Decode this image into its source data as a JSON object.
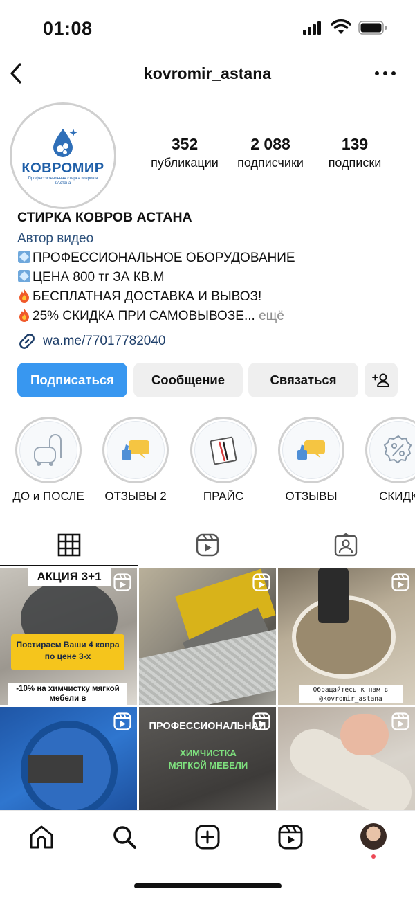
{
  "status": {
    "time": "01:08"
  },
  "header": {
    "username": "kovromir_astana"
  },
  "avatar": {
    "logo_word": "КОВРОМИР",
    "logo_sub": "Профессиональная стирка ковров в г.Астана"
  },
  "stats": [
    {
      "num": "352",
      "label": "публикации"
    },
    {
      "num": "2 088",
      "label": "подписчики"
    },
    {
      "num": "139",
      "label": "подписки"
    }
  ],
  "bio": {
    "name": "СТИРКА КОВРОВ АСТАНА",
    "category": "Автор видео",
    "line1": "ПРОФЕССИОНАЛЬНОЕ ОБОРУДОВАНИЕ",
    "line2": "ЦЕНА 800 тг ЗА КВ.М",
    "line3": "БЕСПЛАТНАЯ ДОСТАВКА И ВЫВОЗ!",
    "line4": "25% СКИДКА ПРИ САМОВЫВОЗЕ...",
    "more": "ещё",
    "link": "wa.me/77017782040"
  },
  "buttons": {
    "follow": "Подписаться",
    "message": "Сообщение",
    "contact": "Связаться"
  },
  "highlights": [
    "ДО и ПОСЛЕ",
    "ОТЗЫВЫ 2",
    "ПРАЙС",
    "ОТЗЫВЫ",
    "СКИДК"
  ],
  "posts": {
    "p1_title": "АКЦИЯ 3+1",
    "p1_offer": "Постираем Ваши 4 ковра по цене 3-х",
    "p1_note": "-10% на химчистку мягкой мебели в",
    "p3_caption": "Обращайтесь к нам в @kovromir_astana",
    "p5_title": "ПРОФЕССИОНАЛЬНАЯ",
    "p5_sub": "ХИМЧИСТКА МЯГКОЙ МЕБЕЛИ"
  },
  "colors": {
    "accent": "#3897f0",
    "link": "#1f3f6a",
    "notif": "#ed4956"
  }
}
